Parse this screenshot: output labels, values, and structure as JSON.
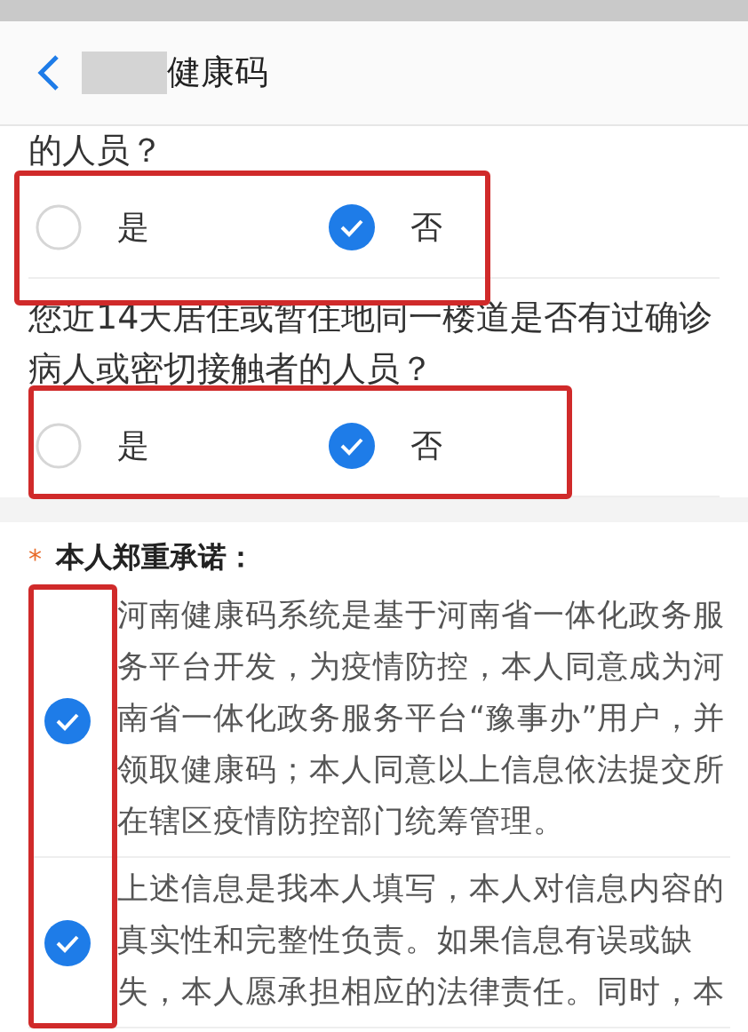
{
  "header": {
    "title": "健康码",
    "title_redacted": true
  },
  "questions": [
    {
      "text": "的人员？",
      "highlighted": true,
      "options": [
        {
          "label": "是",
          "selected": false
        },
        {
          "label": "否",
          "selected": true
        }
      ]
    },
    {
      "text": "您近14天居住或暂住地同一楼道是否有过确诊病人或密切接触者的人员？",
      "highlighted": true,
      "options": [
        {
          "label": "是",
          "selected": false
        },
        {
          "label": "否",
          "selected": true
        }
      ]
    }
  ],
  "pledge": {
    "required_mark": "*",
    "title": "本人郑重承诺：",
    "highlighted": true,
    "items": [
      {
        "text": "河南健康码系统是基于河南省一体化政务服务平台开发，为疫情防控，本人同意成为河南省一体化政务服务平台“豫事办”用户，并领取健康码；本人同意以上信息依法提交所在辖区疫情防控部门统筹管理。",
        "checked": true
      },
      {
        "text": "上述信息是我本人填写，本人对信息内容的真实性和完整性负责。如果信息有误或缺失，本人愿承担相应的法律责任。同时，本",
        "checked": true
      }
    ]
  }
}
